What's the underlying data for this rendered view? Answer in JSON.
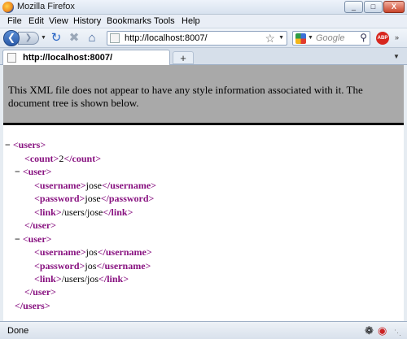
{
  "window": {
    "title": "Mozilla Firefox",
    "buttons": [
      "_",
      "□",
      "X"
    ]
  },
  "menu": [
    "File",
    "Edit",
    "View",
    "History",
    "Bookmarks",
    "Tools",
    "Help"
  ],
  "nav": {
    "url": "http://localhost:8007/",
    "search_placeholder": "Google",
    "icons": [
      "back-icon",
      "forward-icon",
      "reload-icon",
      "stop-icon",
      "home-icon",
      "bookmark-star-icon",
      "adblock-plus-icon"
    ],
    "abp_label": "ABP"
  },
  "tabs": [
    {
      "title": "http://localhost:8007/"
    }
  ],
  "page": {
    "banner": "This XML file does not appear to have any style information associated with it. The document tree is shown below.",
    "xml": {
      "root_open": "<users>",
      "root_close": "</users>",
      "count_open": "<count>",
      "count_value": "2",
      "count_close": "</count>",
      "users": [
        {
          "username": "jose",
          "password": "jose",
          "link": "/users/jose"
        },
        {
          "username": "jos",
          "password": "jos",
          "link": "/users/jos"
        }
      ],
      "user_open": "<user>",
      "user_close": "</user>",
      "username_open": "<username>",
      "username_close": "</username>",
      "password_open": "<password>",
      "password_close": "</password>",
      "link_open": "<link>",
      "link_close": "</link>",
      "collapse_symbol": "−"
    }
  },
  "status": {
    "text": "Done"
  }
}
